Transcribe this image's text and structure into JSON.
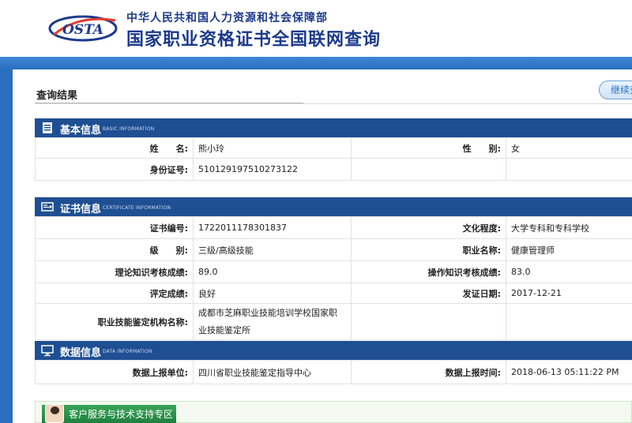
{
  "header": {
    "logo_text": "OSTA",
    "ministry": "中华人民共和国人力资源和社会保障部",
    "site_title": "国家职业资格证书全国联网查询"
  },
  "result": {
    "title": "查询结果",
    "continue_label": "继续查询"
  },
  "sections": {
    "basic": {
      "title": "基本信息",
      "title_en": "BASIC INFORMATION",
      "rows": [
        {
          "label1": "姓　　名:",
          "value1": "熊小玲",
          "label2": "性　　别:",
          "value2": "女"
        },
        {
          "label1": "身份证号:",
          "value1": "510129197510273122",
          "label2": "",
          "value2": ""
        }
      ]
    },
    "cert": {
      "title": "证书信息",
      "title_en": "CERTIFICATE INFORMATION",
      "rows": [
        {
          "label1": "证书编号:",
          "value1": "1722011178301837",
          "label2": "文化程度:",
          "value2": "大学专科和专科学校"
        },
        {
          "label1": "级　　别:",
          "value1": "三级/高级技能",
          "label2": "职业名称:",
          "value2": "健康管理师"
        },
        {
          "label1": "理论知识考核成绩:",
          "value1": "89.0",
          "label2": "操作知识考核成绩:",
          "value2": "83.0"
        },
        {
          "label1": "评定成绩:",
          "value1": "良好",
          "label2": "发证日期:",
          "value2": "2017-12-21"
        },
        {
          "label1": "职业技能鉴定机构名称:",
          "value1_line1": "成都市芝麻职业技能培训学校国家职",
          "value1_line2": "业技能鉴定所",
          "label2": "",
          "value2": ""
        }
      ]
    },
    "data": {
      "title": "数据信息",
      "title_en": "DATA INFORMATION",
      "rows": [
        {
          "label1": "数据上报单位:",
          "value1": "四川省职业技能鉴定指导中心",
          "label2": "数据上报时间:",
          "value2": "2018-06-13 05:11:22 PM"
        }
      ]
    }
  },
  "footer": {
    "support_label": "客户服务与技术支持专区"
  },
  "colors": {
    "brand_blue": "#2a6ec0",
    "section_header": "#1f4f93",
    "footer_green": "#1d7f3c"
  }
}
